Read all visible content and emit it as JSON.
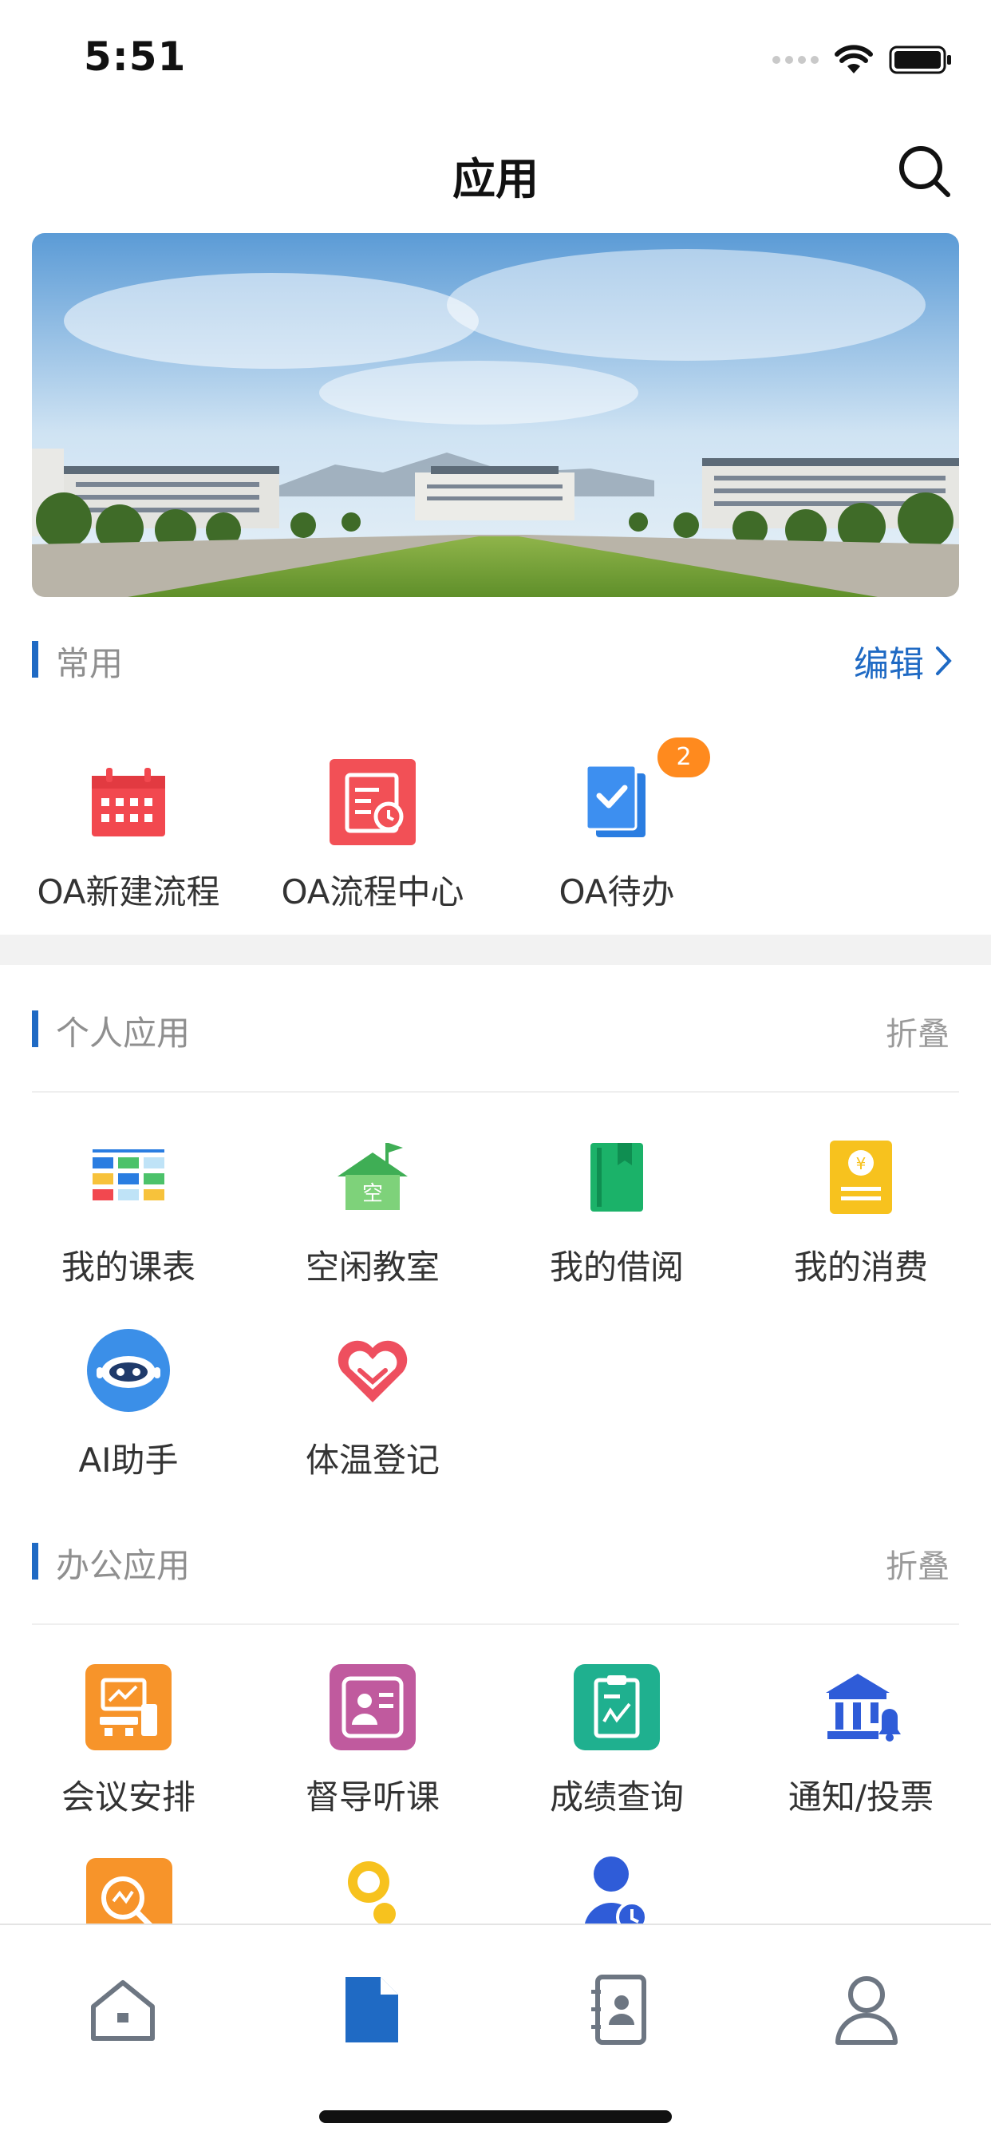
{
  "status": {
    "time": "5:51"
  },
  "header": {
    "title": "应用"
  },
  "favorites": {
    "title": "常用",
    "edit_label": "编辑",
    "items": [
      {
        "label": "OA新建流程",
        "icon": "calendar-icon",
        "color": "#f2484f"
      },
      {
        "label": "OA流程中心",
        "icon": "process-center-icon",
        "color": "#f25056"
      },
      {
        "label": "OA待办",
        "icon": "todo-icon",
        "color": "#2a7de1",
        "badge": "2"
      }
    ]
  },
  "personal": {
    "title": "个人应用",
    "collapse_label": "折叠",
    "items": [
      {
        "label": "我的课表",
        "icon": "timetable-icon"
      },
      {
        "label": "空闲教室",
        "icon": "classroom-icon"
      },
      {
        "label": "我的借阅",
        "icon": "book-icon"
      },
      {
        "label": "我的消费",
        "icon": "consumption-icon"
      },
      {
        "label": "AI助手",
        "icon": "ai-assistant-icon"
      },
      {
        "label": "体温登记",
        "icon": "temperature-heart-icon"
      }
    ]
  },
  "office": {
    "title": "办公应用",
    "collapse_label": "折叠",
    "items": [
      {
        "label": "会议安排",
        "icon": "meeting-icon"
      },
      {
        "label": "督导听课",
        "icon": "supervision-icon"
      },
      {
        "label": "成绩查询",
        "icon": "grades-icon"
      },
      {
        "label": "通知/投票",
        "icon": "notice-vote-icon"
      }
    ]
  },
  "tabbar": {
    "items": [
      {
        "name": "home",
        "icon": "home-icon",
        "active": false
      },
      {
        "name": "apps",
        "icon": "document-icon",
        "active": true
      },
      {
        "name": "contacts",
        "icon": "contacts-icon",
        "active": false
      },
      {
        "name": "profile",
        "icon": "user-icon",
        "active": false
      }
    ]
  },
  "colors": {
    "accent": "#1f6ac4",
    "muted": "#8f8f8f"
  }
}
